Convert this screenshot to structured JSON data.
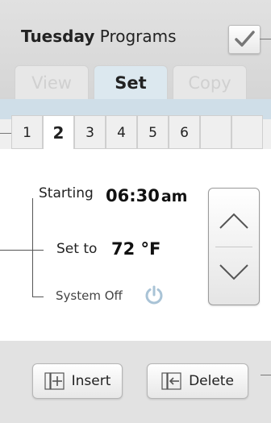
{
  "header": {
    "day": "Tuesday",
    "title_suffix": "Programs"
  },
  "mode_tabs": [
    {
      "label": "View",
      "active": false
    },
    {
      "label": "Set",
      "active": true
    },
    {
      "label": "Copy",
      "active": false
    }
  ],
  "program_tabs": [
    {
      "label": "1",
      "active": false
    },
    {
      "label": "2",
      "active": true
    },
    {
      "label": "3",
      "active": false
    },
    {
      "label": "4",
      "active": false
    },
    {
      "label": "5",
      "active": false
    },
    {
      "label": "6",
      "active": false
    },
    {
      "label": "",
      "active": false
    },
    {
      "label": "",
      "active": false
    }
  ],
  "program": {
    "starting_label": "Starting",
    "start_time": "06:30",
    "start_ampm": "am",
    "setto_label": "Set to",
    "setpoint": "72 °F",
    "system_off_label": "System Off"
  },
  "buttons": {
    "insert_label": "Insert",
    "delete_label": "Delete"
  },
  "icons": {
    "confirm": "checkmark-icon",
    "power": "power-icon",
    "up": "chevron-up-icon",
    "down": "chevron-down-icon",
    "insert": "insert-icon",
    "delete": "delete-icon"
  }
}
